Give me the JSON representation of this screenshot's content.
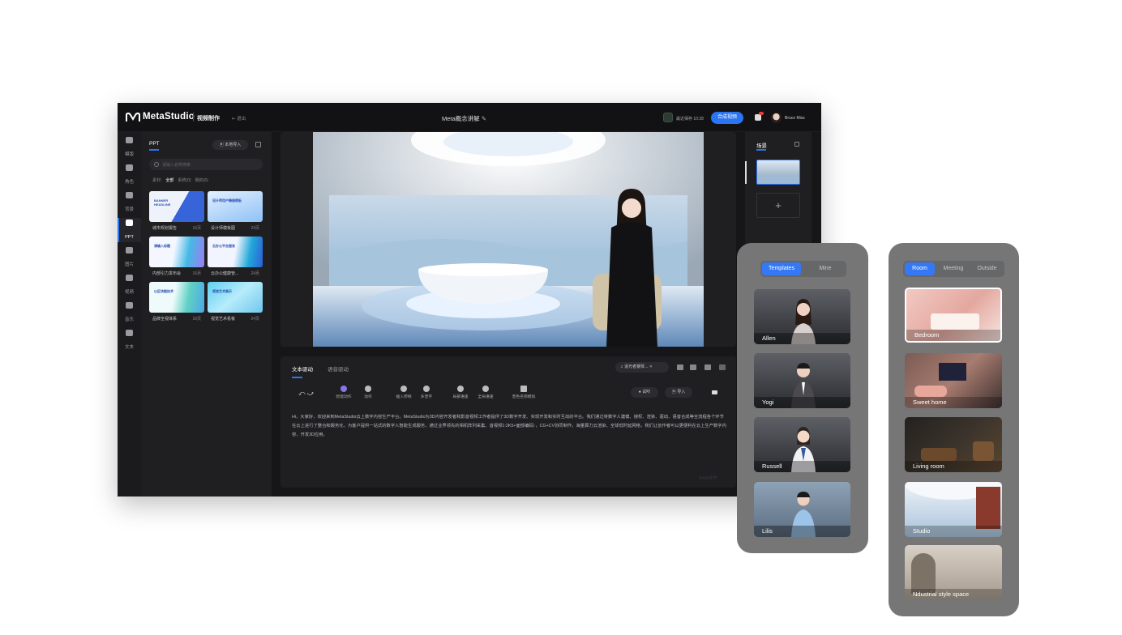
{
  "app": {
    "logo": "MetaStudio",
    "section_title": "视频制作",
    "exit_label": "退出",
    "doc_title": "Meta概念讲解",
    "save_status": "最近保存 10:28",
    "compose_button": "合成视频",
    "username": "Bruce Miss"
  },
  "left_nav": [
    {
      "label": "模版",
      "icon": "template-icon"
    },
    {
      "label": "角色",
      "icon": "person-icon"
    },
    {
      "label": "背景",
      "icon": "background-icon"
    },
    {
      "label": "PPT",
      "icon": "ppt-icon",
      "active": true
    },
    {
      "label": "图片",
      "icon": "image-icon"
    },
    {
      "label": "视频",
      "icon": "video-icon"
    },
    {
      "label": "音乐",
      "icon": "music-icon"
    },
    {
      "label": "文本",
      "icon": "text-icon"
    }
  ],
  "ppt_panel": {
    "tab": "PPT",
    "import_button": "本地导入",
    "search_placeholder": "请输入名称搜索",
    "filter_prefix": "素材:",
    "filters": [
      "全部",
      "系统(0)",
      "我的(6)"
    ],
    "cards": [
      {
        "caption": "城市规划报告",
        "count": "16页",
        "thumb_text": "BANNER HEADLINE"
      },
      {
        "caption": "设计师模板图",
        "count": "24页",
        "thumb_text": "设计师用户精细模板"
      },
      {
        "caption": "内部引力发布会",
        "count": "16页",
        "thumb_text": "请输入标题"
      },
      {
        "caption": "云办公健康管...",
        "count": "24页",
        "thumb_text": "云办公平台服务"
      },
      {
        "caption": "品牌全视体系",
        "count": "16页",
        "thumb_text": "以区块链技术"
      },
      {
        "caption": "视觉艺术看板",
        "count": "24页",
        "thumb_text": "视觉艺术展示"
      }
    ]
  },
  "editor": {
    "tabs": [
      "文本驱动",
      "语音驱动"
    ],
    "music_chip": "追光者钢琴...",
    "tools": [
      "智能动作",
      "动作",
      "插入停顿",
      "多音字",
      "局部语速",
      "全局语速",
      "音色名称模拟"
    ],
    "listen_button": "试听",
    "import_button": "导入",
    "body": "Hi，大家好，欢迎来到MetaStudio云上数字内容生产平台。MetaStudio为3D内容开发者和影音视频工作者提供了3D数字开发、实现开发和实时互动的平台。我们通过将数字人建模、授权、渲染、驱动、语音合成等全流程各个环节在云上进行了整合和服务化，为客户提供一站式的数字人智能生成服务，通过业界领先的相机阵列采集、音视频1:2K5+面部编码），CG+CV协同制作，海量算力云渲染、全球低时延网络，我们让创作者可以更便利在云上生产数字内容，开发3D应用。",
    "watermark": "0/400字符"
  },
  "scene_panel": {
    "tab": "场景",
    "add_label": "+"
  },
  "templates_panel": {
    "segments": [
      "Templates",
      "Mine"
    ],
    "active": "Templates",
    "items": [
      "Allen",
      "Yogi",
      "Russell",
      "Lilis"
    ]
  },
  "backgrounds_panel": {
    "segments": [
      "Room",
      "Meeting",
      "Outside"
    ],
    "active": "Room",
    "items": [
      "Bedroom",
      "Sweet home",
      "Living room",
      "Studio",
      "Ndustrial style space"
    ]
  },
  "colors": {
    "accent": "#2b74f2",
    "app_bg": "#161618",
    "panel_gray": "#767677"
  }
}
